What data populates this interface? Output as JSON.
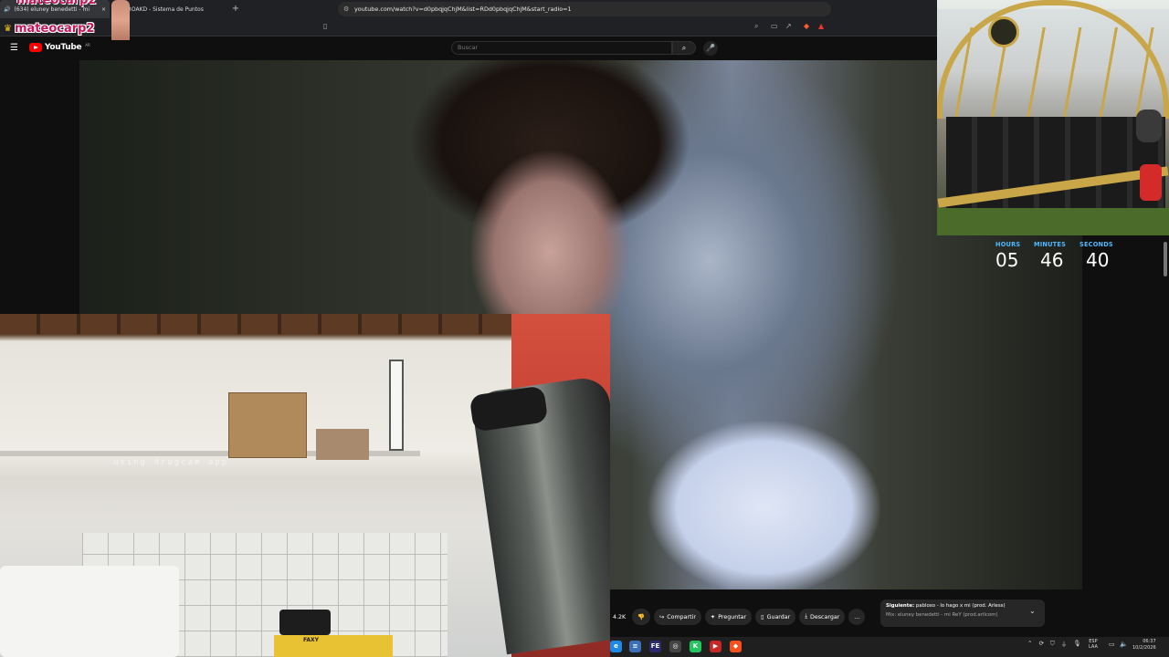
{
  "browser": {
    "tabs": [
      {
        "label": "(634) eluney benedetti - mi"
      },
      {
        "label": "MAUROAKD - Sistema de Puntos"
      }
    ],
    "new_tab_symbol": "+",
    "url": "youtube.com/watch?v=d0pbqjqChjM&list=RDd0pbqjqChjM&start_radio=1"
  },
  "youtube": {
    "logo_text": "YouTube",
    "country_code": "AR",
    "search_placeholder": "Buscar"
  },
  "overlay": {
    "streamer_name": "mateocarp2",
    "webcam_caption": "using drugcam app",
    "countdown": {
      "hours_label": "HOURS",
      "minutes_label": "MINUTES",
      "seconds_label": "SECONDS",
      "hours": "05",
      "minutes": "46",
      "seconds": "40"
    },
    "yellow_box_text": "FAXY"
  },
  "actions": {
    "likes": "4.2K",
    "share": "Compartir",
    "ask": "Preguntar",
    "save": "Guardar",
    "download": "Descargar",
    "more": "..."
  },
  "up_next": {
    "prefix": "Siguiente:",
    "title": "pabloxo - lo hago x mi (prod. Arless)",
    "subtitle": "Mix: eluney benedetti - mi ReY (prod.arilcom)"
  },
  "taskbar": {
    "language": "ESP",
    "region": "LAA",
    "time": "06:37",
    "date": "10/2/2026"
  },
  "colors": {
    "accent_red": "#ff0000",
    "countdown_label": "#4fb8ff",
    "streamer_name": "#c2185b"
  }
}
